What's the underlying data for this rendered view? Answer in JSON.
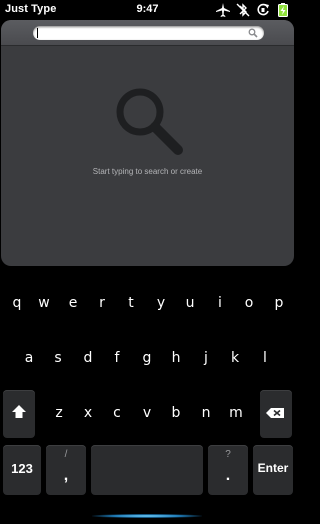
{
  "status_bar": {
    "app_name": "Just Type",
    "time": "9:47",
    "icons": [
      "airplane-icon",
      "bluetooth-off-icon",
      "rotate-icon",
      "battery-charging-icon"
    ]
  },
  "search": {
    "placeholder": "",
    "hint": "Start typing to search or create"
  },
  "keyboard": {
    "row1": [
      "q",
      "w",
      "e",
      "r",
      "t",
      "y",
      "u",
      "i",
      "o",
      "p"
    ],
    "row2": [
      "a",
      "s",
      "d",
      "f",
      "g",
      "h",
      "j",
      "k",
      "l"
    ],
    "row3": [
      "z",
      "x",
      "c",
      "v",
      "b",
      "n",
      "m"
    ],
    "bottom": {
      "numbers": "123",
      "slash": "/",
      "comma": ",",
      "question": "?",
      "period": ".",
      "enter": "Enter"
    }
  },
  "colors": {
    "card_bg": "#3b3c3f",
    "key_bg": "#2b2c2e",
    "gesture_glow": "#4fc3ff"
  }
}
